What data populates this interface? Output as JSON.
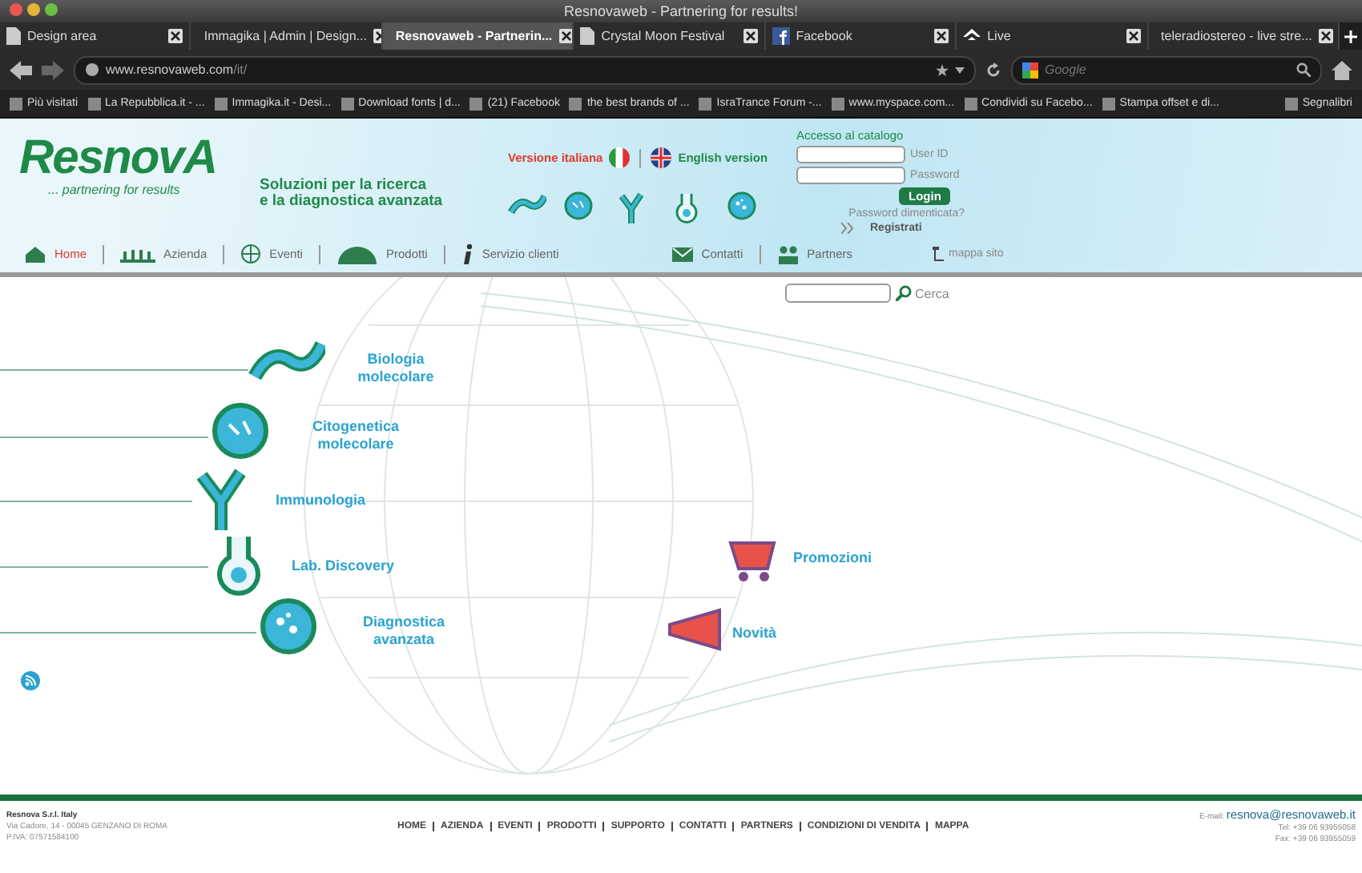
{
  "window": {
    "title": "Resnovaweb - Partnering for results!"
  },
  "tabs": [
    {
      "label": "Design area",
      "selected": false,
      "kind": "page"
    },
    {
      "label": "Immagika | Admin | Design...",
      "selected": false,
      "kind": "page"
    },
    {
      "label": "Resnovaweb - Partnerin...",
      "selected": true,
      "kind": "page"
    },
    {
      "label": "Crystal Moon Festival",
      "selected": false,
      "kind": "page"
    },
    {
      "label": "Facebook",
      "selected": false,
      "kind": "facebook"
    },
    {
      "label": "Live",
      "selected": false,
      "kind": "live"
    },
    {
      "label": "teleradiostereo - live stre...",
      "selected": false,
      "kind": "radio"
    }
  ],
  "address_bar": {
    "url_host": "www.resnovaweb.com",
    "url_path": "/it/"
  },
  "search_engine": {
    "placeholder": "Google"
  },
  "bookmarks": [
    {
      "label": "Più visitati"
    },
    {
      "label": "La Repubblica.it - ..."
    },
    {
      "label": "Immagika.it - Desi..."
    },
    {
      "label": "Download fonts | d..."
    },
    {
      "label": "(21) Facebook"
    },
    {
      "label": "the best brands of ..."
    },
    {
      "label": "IsraTrance Forum -..."
    },
    {
      "label": "www.myspace.com..."
    },
    {
      "label": "Condividi su Facebo..."
    },
    {
      "label": "Stampa offset e di..."
    }
  ],
  "bookmarks_menu": "Segnalibri",
  "site": {
    "logo": "ResnovA",
    "tagline": "... partnering for results",
    "slogan": [
      "Soluzioni per la ricerca",
      "e la diagnostica avanzata"
    ],
    "languages": [
      {
        "label": "Versione italiana",
        "selected": true,
        "kind": "it"
      },
      {
        "label": "English version",
        "selected": false,
        "kind": "en"
      }
    ],
    "login": {
      "title": "Accesso  al catalogo",
      "fields": [
        {
          "label": "User ID"
        },
        {
          "label": "Password"
        }
      ],
      "button": "Login",
      "forgot": "Password dimenticata?",
      "register": "Registrati",
      "sitemap": "mappa sito"
    },
    "nav": [
      {
        "label": "Home",
        "selected": true,
        "kind": "home"
      },
      {
        "label": "Azienda",
        "selected": false,
        "kind": "company"
      },
      {
        "label": "Eventi",
        "selected": false,
        "kind": "globe"
      },
      {
        "label": "Prodotti",
        "selected": false,
        "kind": "products"
      },
      {
        "label": "Servizio clienti",
        "selected": false,
        "kind": "info"
      },
      {
        "label": "Contatti",
        "selected": false,
        "kind": "mail"
      },
      {
        "label": "Partners",
        "selected": false,
        "kind": "people"
      }
    ],
    "search": {
      "button": "Cerca"
    },
    "categories": [
      {
        "label": "Biologia molecolare",
        "kind": "dna"
      },
      {
        "label": "Citogenetica molecolare",
        "kind": "cell"
      },
      {
        "label": "Immunologia",
        "kind": "antibody"
      },
      {
        "label": "Lab. Discovery",
        "kind": "flask"
      },
      {
        "label": "Diagnostica avanzata",
        "kind": "dots"
      }
    ],
    "promos": [
      {
        "label": "Promozioni",
        "kind": "cart"
      },
      {
        "label": "Novità",
        "kind": "megaphone"
      }
    ],
    "footer": {
      "company": "Resnova S.r.l. Italy",
      "address": "Via Cadore, 14 - 00045 GENZANO DI ROMA",
      "vat": "P.IVA: 07571584100",
      "links": [
        "HOME",
        "AZIENDA",
        "EVENTI",
        "PRODOTTI",
        "SUPPORTO",
        "CONTATTI",
        "PARTNERS",
        "CONDIZIONI DI VENDITA",
        "MAPPA"
      ],
      "email_label": "E-mail:",
      "email": "resnova@resnovaweb.it",
      "tel": "Tel: +39 06 93955058",
      "fax": "Fax: +39 06 93955059"
    }
  }
}
